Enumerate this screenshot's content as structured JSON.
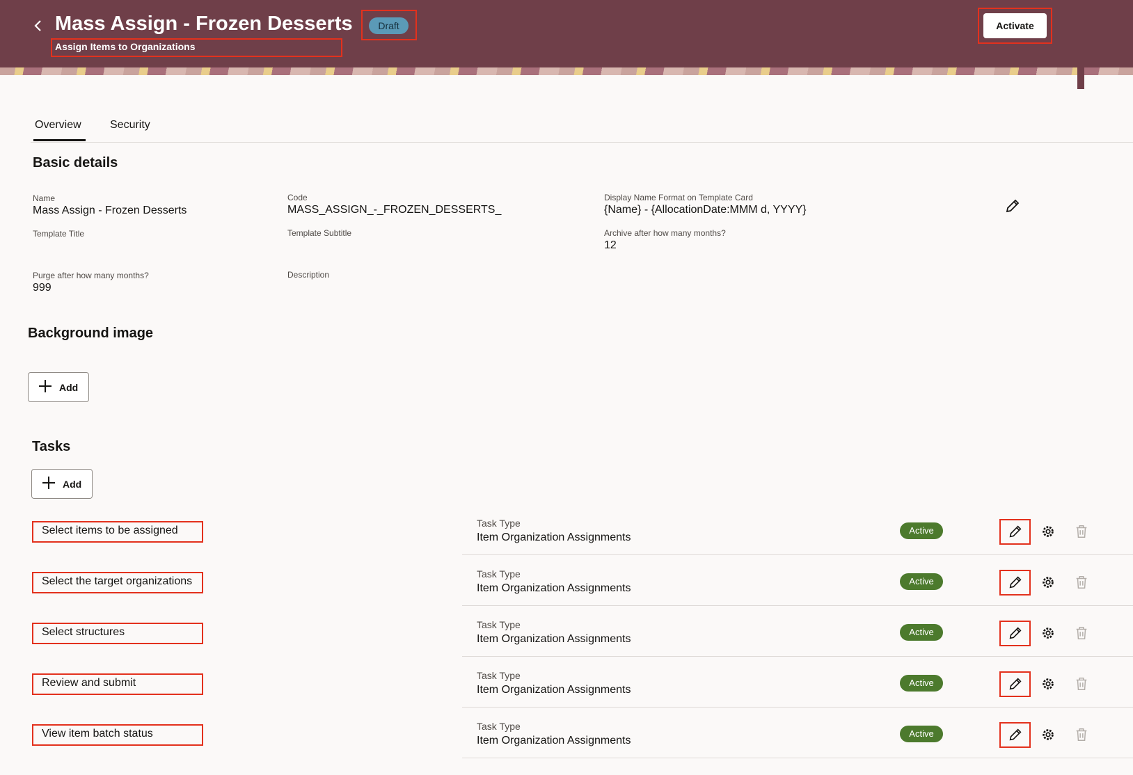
{
  "header": {
    "back_icon": "chevron-left-icon",
    "title": "Mass Assign - Frozen Desserts",
    "subtitle": "Assign Items to Organizations",
    "status_badge": "Draft",
    "activate_label": "Activate",
    "colors": {
      "header_bg": "#6f3f49",
      "draft_badge": "#5b9ab7",
      "highlight": "#e3311d"
    }
  },
  "tabs": [
    {
      "label": "Overview",
      "selected": true
    },
    {
      "label": "Security",
      "selected": false
    }
  ],
  "basic_details": {
    "title": "Basic details",
    "fields": {
      "name": {
        "label": "Name",
        "value": "Mass Assign - Frozen Desserts"
      },
      "code": {
        "label": "Code",
        "value": "MASS_ASSIGN_-_FROZEN_DESSERTS_"
      },
      "display_format": {
        "label": "Display Name Format on Template Card",
        "value": "{Name} - {AllocationDate:MMM d, YYYY}"
      },
      "template_title": {
        "label": "Template Title",
        "value": ""
      },
      "template_subtitle": {
        "label": "Template Subtitle",
        "value": ""
      },
      "archive": {
        "label": "Archive after how many months?",
        "value": "12"
      },
      "purge": {
        "label": "Purge after how many months?",
        "value": "999"
      },
      "description": {
        "label": "Description",
        "value": ""
      }
    },
    "edit_icon": "pencil-icon"
  },
  "background_image": {
    "title": "Background image",
    "add_label": "Add"
  },
  "tasks": {
    "title": "Tasks",
    "add_label": "Add",
    "items": [
      {
        "name": "Select items to be assigned",
        "type_label": "Task Type",
        "type": "Item Organization Assignments",
        "status": "Active"
      },
      {
        "name": "Select the target organizations",
        "type_label": "Task Type",
        "type": "Item Organization Assignments",
        "status": "Active"
      },
      {
        "name": "Select structures",
        "type_label": "Task Type",
        "type": "Item Organization Assignments",
        "status": "Active"
      },
      {
        "name": "Review and submit",
        "type_label": "Task Type",
        "type": "Item Organization Assignments",
        "status": "Active"
      },
      {
        "name": "View item batch status",
        "type_label": "Task Type",
        "type": "Item Organization Assignments",
        "status": "Active"
      }
    ],
    "row_icons": [
      "pencil-icon",
      "gear-icon",
      "trash-icon"
    ],
    "status_color": "#4c7a2d"
  }
}
